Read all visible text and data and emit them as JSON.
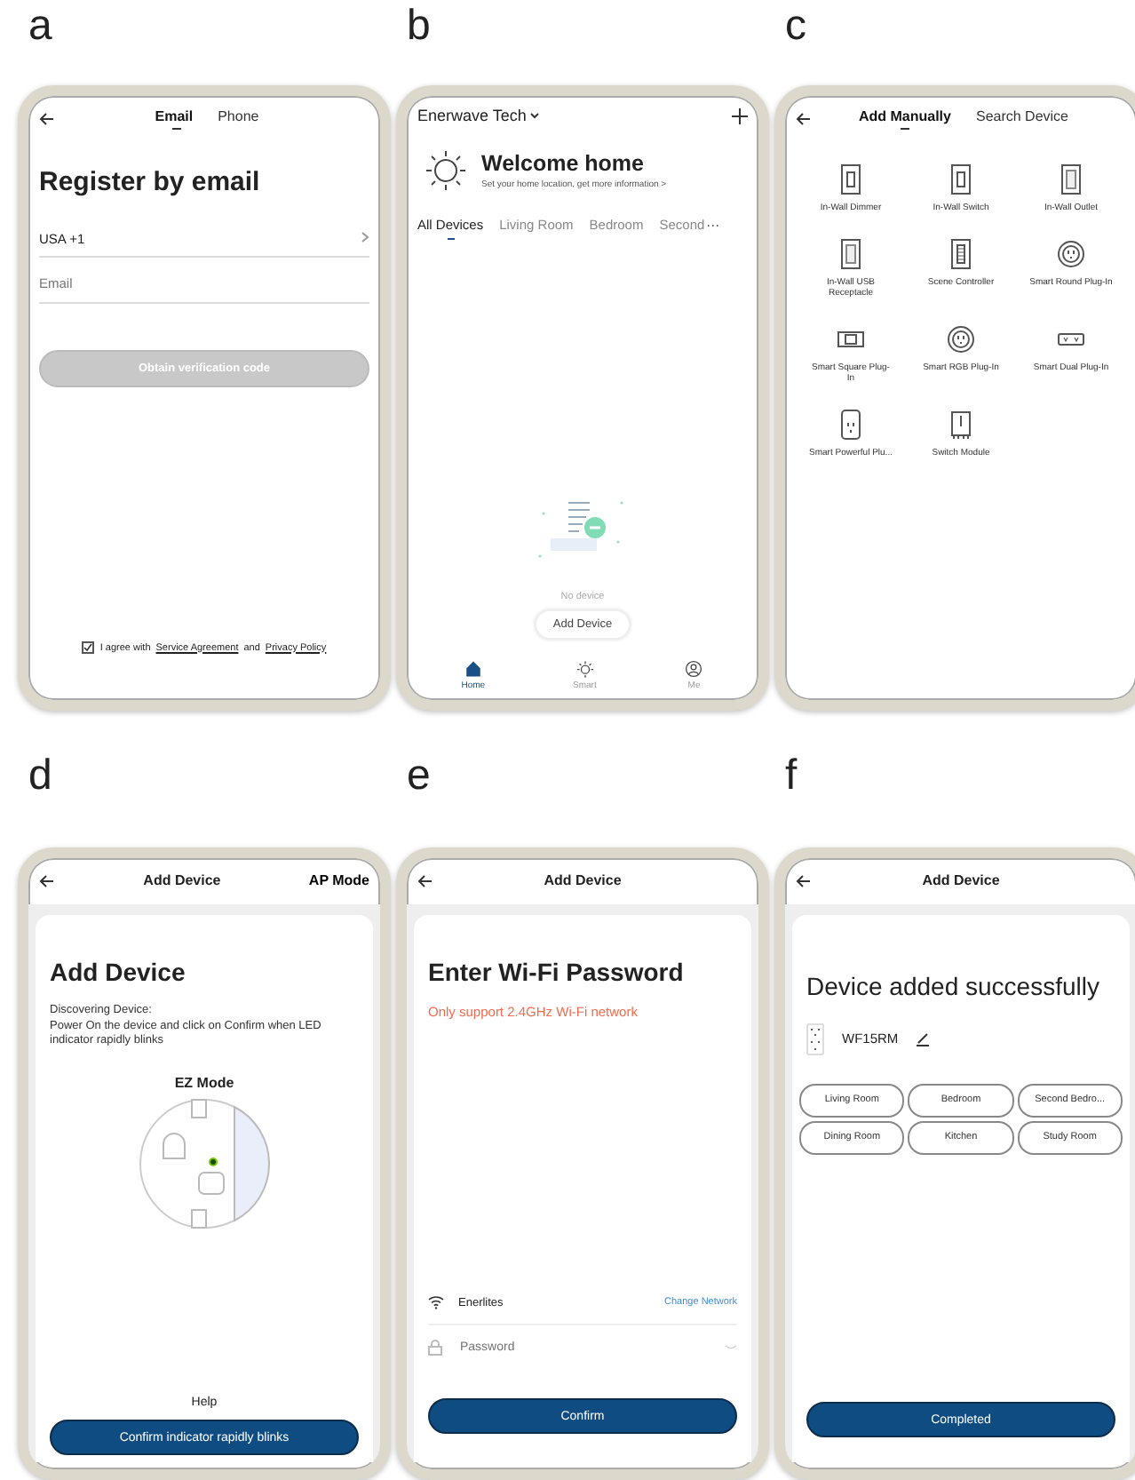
{
  "panels": [
    {
      "kind": "register",
      "letter": "a",
      "tabs": [
        {
          "label": "Email",
          "selected": true
        },
        {
          "label": "Phone",
          "selected": false
        }
      ],
      "title": "Register by email",
      "region": "USA +1",
      "email": {
        "placeholder": "Email"
      },
      "button": "Obtain verification code",
      "agree": {
        "checked": true,
        "text": "I agree with",
        "link1": "Service Agreement",
        "joiner": "and",
        "link2": "Privacy Policy"
      }
    },
    {
      "kind": "home",
      "letter": "b",
      "home_name": "Enerwave Tech",
      "welcome": "Welcome home",
      "subtitle": "Set your home location, get more information >",
      "tabs": [
        {
          "label": "All Devices",
          "selected": true
        },
        {
          "label": "Living Room",
          "selected": false
        },
        {
          "label": "Bedroom",
          "selected": false
        },
        {
          "label": "Second",
          "selected": false
        }
      ],
      "more": "···",
      "empty_text": "No device",
      "add_button": "Add Device",
      "nav": [
        {
          "kind": "home",
          "label": "Home",
          "selected": true
        },
        {
          "kind": "smart",
          "label": "Smart",
          "selected": false
        },
        {
          "kind": "me",
          "label": "Me",
          "selected": false
        }
      ]
    },
    {
      "kind": "catalog",
      "letter": "c",
      "tabs": [
        {
          "label": "Add Manually",
          "selected": true
        },
        {
          "label": "Search Device",
          "selected": false
        }
      ],
      "devices": [
        {
          "kind": "switch",
          "label": "In-Wall Dimmer"
        },
        {
          "kind": "switch",
          "label": "In-Wall Switch"
        },
        {
          "kind": "outlet",
          "label": "In-Wall Outlet"
        },
        {
          "kind": "outlet",
          "label": "In-Wall USB Receptacle"
        },
        {
          "kind": "keypad",
          "label": "Scene Controller"
        },
        {
          "kind": "round",
          "label": "Smart Round Plug-In"
        },
        {
          "kind": "square",
          "label": "Smart Square Plug-In"
        },
        {
          "kind": "round",
          "label": "Smart RGB Plug-In"
        },
        {
          "kind": "dual",
          "label": "Smart Dual Plug-In"
        },
        {
          "kind": "plug",
          "label": "Smart Powerful Plu..."
        },
        {
          "kind": "module",
          "label": "Switch Module"
        }
      ]
    },
    {
      "kind": "discover",
      "letter": "d",
      "header": "Add Device",
      "action": "AP Mode",
      "heading": "Add Device",
      "lines": [
        "Discovering Device:",
        "Power On the device and click on Confirm when LED indicator rapidly blinks"
      ],
      "mode": "EZ Mode",
      "help": "Help",
      "button": "Confirm indicator rapidly blinks"
    },
    {
      "kind": "wifi",
      "letter": "e",
      "header": "Add Device",
      "heading": "Enter Wi-Fi Password",
      "warning": "Only support 2.4GHz Wi-Fi network",
      "network": "Enerlites",
      "change": "Change Network",
      "password": {
        "placeholder": "Password"
      },
      "button": "Confirm"
    },
    {
      "kind": "success",
      "letter": "f",
      "header": "Add Device",
      "heading": "Device added successfully",
      "device_name": "WF15RM",
      "rooms": [
        "Living Room",
        "Bedroom",
        "Second Bedro...",
        "Dining Room",
        "Kitchen",
        "Study Room"
      ],
      "button": "Completed"
    }
  ]
}
